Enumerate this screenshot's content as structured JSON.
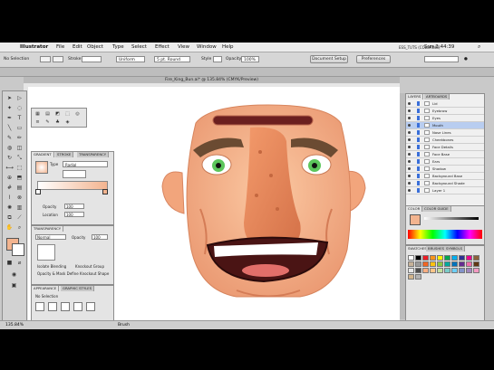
{
  "menubar": {
    "app": "Illustrator",
    "items": [
      "File",
      "Edit",
      "Object",
      "Type",
      "Select",
      "Effect",
      "View",
      "Window",
      "Help"
    ],
    "clock": "Sun 3:44:39",
    "user": "ESS_TUTS (COLORING)"
  },
  "control_bar": {
    "selection": "No Selection",
    "stroke_label": "Stroke",
    "brush": "5 pt. Round",
    "uniform": "Uniform",
    "style_label": "Style",
    "opacity_label": "Opacity",
    "opacity_value": "100%",
    "doc_setup": "Document Setup",
    "preferences": "Preferences"
  },
  "document": {
    "tab": "Fire_King_Bun.ai* @ 135.84% (CMYK/Preview)"
  },
  "gradient_panel": {
    "tabs": [
      "GRADIENT",
      "STROKE",
      "TRANSPARENCY"
    ],
    "type_label": "Type",
    "type_value": "Radial",
    "opacity_label": "Opacity",
    "location_label": "Location",
    "opacity_value": "100",
    "location_value": "100"
  },
  "transparency_panel": {
    "tab": "TRANSPARENCY",
    "mode": "Normal",
    "opacity_label": "Opacity",
    "opacity_value": "100",
    "checks": [
      "Isolate Blending",
      "Knockout Group",
      "Opacity & Mask Define Knockout Shape"
    ]
  },
  "appearance_panel": {
    "tabs": [
      "APPEARANCE",
      "GRAPHIC STYLES"
    ],
    "line": "No Selection"
  },
  "layers_panel": {
    "tabs": [
      "LAYERS",
      "ARTBOARDS"
    ],
    "rows": [
      "Lid",
      "Eyebrow",
      "Eyes",
      "Mouth",
      "Nose Lines",
      "Cheekbones",
      "Face Details",
      "Face Base",
      "Ears",
      "Shadow",
      "Background Base",
      "Background Shade",
      "Layer 1"
    ]
  },
  "color_panel": {
    "tabs": [
      "COLOR",
      "COLOR GUIDE"
    ]
  },
  "swatches_panel": {
    "tabs": [
      "SWATCHES",
      "BRUSHES",
      "SYMBOLS"
    ],
    "colors": [
      "#ffffff",
      "#000000",
      "#ed1c24",
      "#f7941d",
      "#fff200",
      "#00a651",
      "#00aeef",
      "#2e3192",
      "#ec008c",
      "#8c6239",
      "#c7b299",
      "#999999",
      "#f26522",
      "#ffc20e",
      "#8dc63f",
      "#00a99d",
      "#0072bc",
      "#662d91",
      "#f06eaa",
      "#603913",
      "#e6e6e6",
      "#4d4d4d",
      "#f9ad81",
      "#fdc689",
      "#c4df9b",
      "#7accc8",
      "#6dcff6",
      "#8393ca",
      "#a186be",
      "#f49ac2",
      "#d2b48c",
      "#b3b3b3"
    ]
  },
  "status": {
    "zoom": "135.84%",
    "tool": "Brush"
  },
  "colors": {
    "skin": "#f7b48a",
    "skin_shadow": "#e89670",
    "nose": "#e8875a",
    "mouth": "#5a1a1a",
    "iris": "#4cc24c"
  }
}
